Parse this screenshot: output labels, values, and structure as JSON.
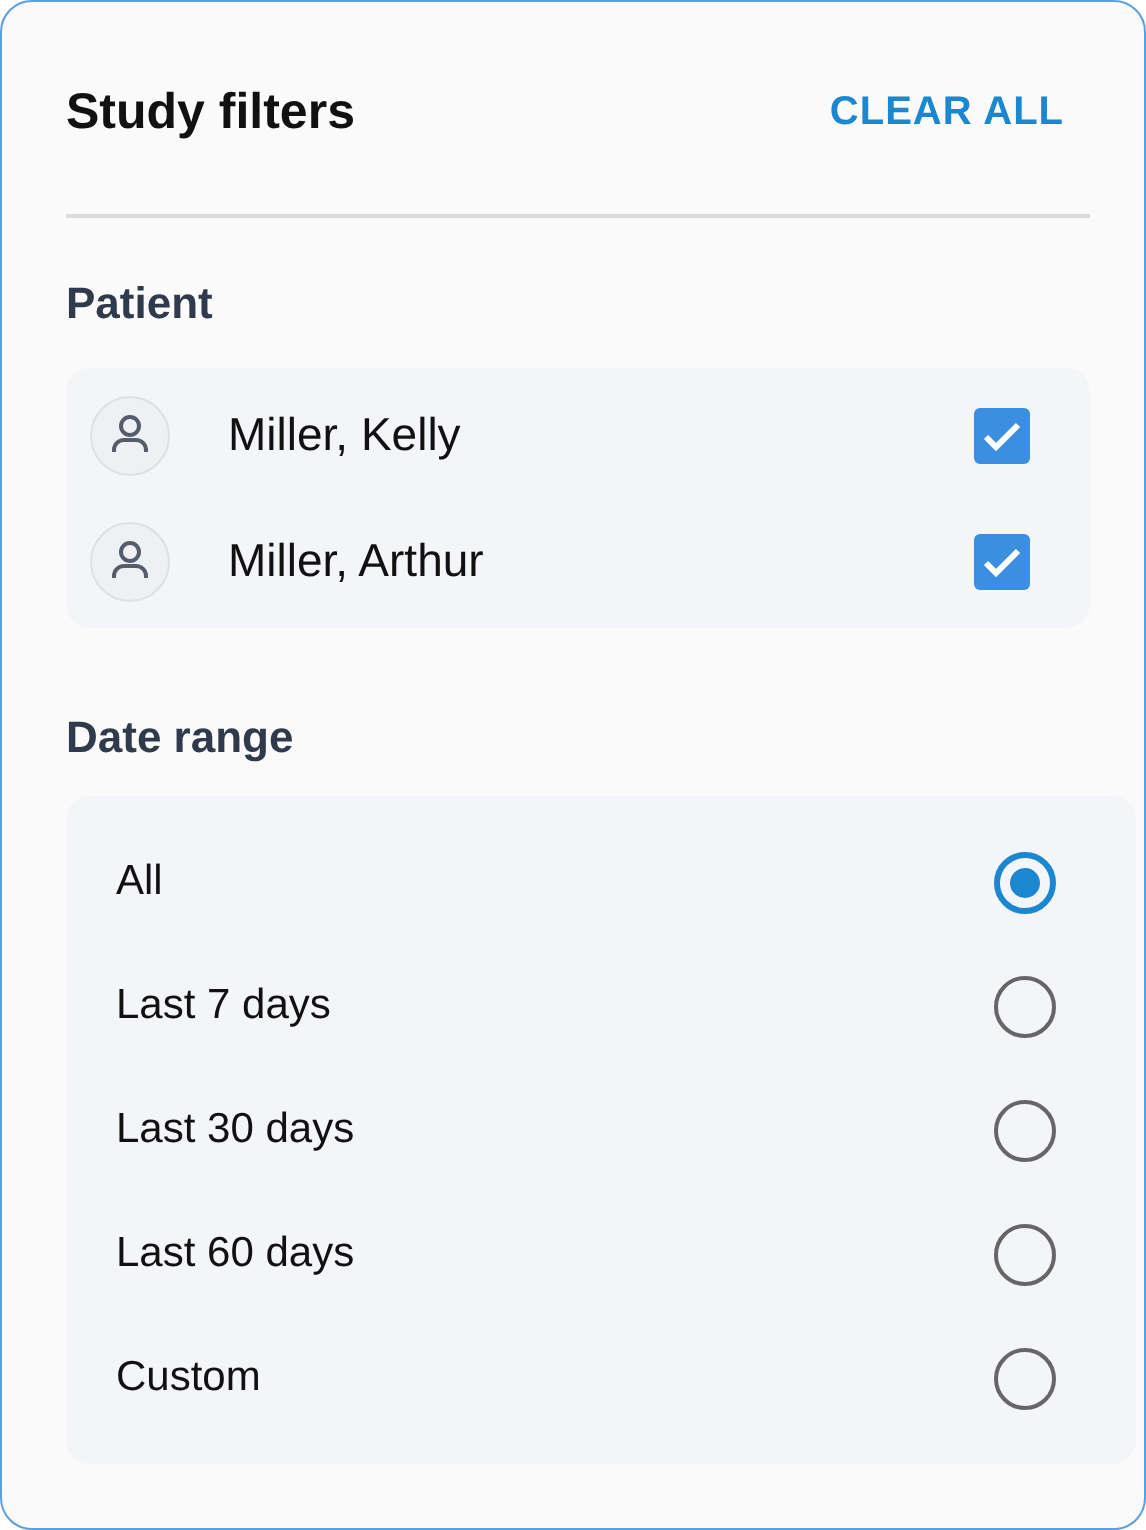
{
  "header": {
    "title": "Study filters",
    "action": "CLEAR ALL"
  },
  "patient_section": {
    "heading": "Patient",
    "patients": [
      {
        "name": "Miller, Kelly",
        "checked": true
      },
      {
        "name": "Miller, Arthur",
        "checked": true
      }
    ]
  },
  "date_range_section": {
    "heading": "Date range",
    "options": [
      {
        "label": "All",
        "selected": true
      },
      {
        "label": "Last 7 days",
        "selected": false
      },
      {
        "label": "Last 30 days",
        "selected": false
      },
      {
        "label": "Last 60 days",
        "selected": false
      },
      {
        "label": "Custom",
        "selected": false
      }
    ]
  }
}
